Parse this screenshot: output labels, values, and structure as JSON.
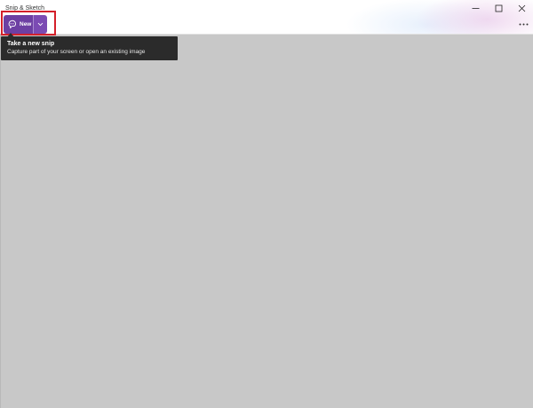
{
  "window": {
    "title": "Snip & Sketch",
    "controls": {
      "minimize_icon": "minimize-icon",
      "maximize_icon": "maximize-icon",
      "close_icon": "close-icon"
    }
  },
  "toolbar": {
    "new_label": "New",
    "new_icon": "snip-icon",
    "dropdown_icon": "chevron-down-icon",
    "more_icon": "more-icon"
  },
  "tooltip": {
    "title": "Take a new snip",
    "description": "Capture part of your screen or open an existing image"
  },
  "colors": {
    "accent": "#6d3fa3",
    "accent_secondary": "#7b4bb3",
    "highlight": "#d4202a",
    "tooltip_bg": "#2b2b2b",
    "canvas": "#c8c8c8"
  }
}
